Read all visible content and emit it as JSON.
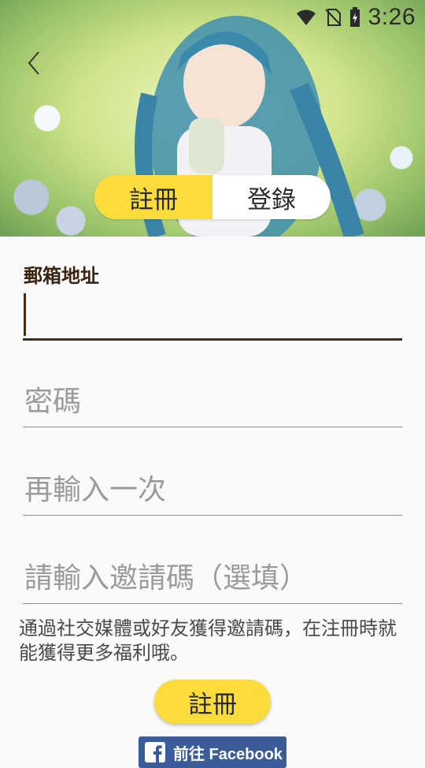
{
  "status_bar": {
    "time": "3:26",
    "icons": [
      "wifi-icon",
      "no-sim-icon",
      "battery-charging-icon"
    ]
  },
  "header": {
    "back_icon": "chevron-left-icon",
    "tabs": [
      {
        "label": "註冊",
        "active": true
      },
      {
        "label": "登錄",
        "active": false
      }
    ],
    "colors": {
      "accent": "#fbdc3b"
    }
  },
  "form": {
    "email": {
      "label": "郵箱地址",
      "value": "",
      "placeholder": ""
    },
    "password": {
      "placeholder": "密碼"
    },
    "repeat_password": {
      "placeholder": "再輸入一次"
    },
    "invite_code": {
      "placeholder": "請輸入邀請碼（選填）"
    },
    "hint": "通過社交媒體或好友獲得邀請碼，在注冊時就能獲得更多福利哦。",
    "submit_label": "註冊"
  },
  "facebook": {
    "label": "前往 Facebook",
    "icon": "facebook-icon",
    "color": "#3b5c9b"
  }
}
